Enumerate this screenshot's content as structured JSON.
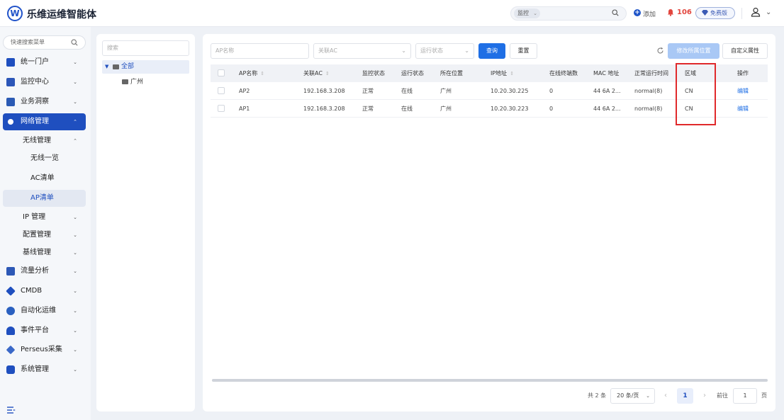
{
  "header": {
    "logo_letter": "W",
    "app_title": "乐维运维智能体",
    "search_scope": "监控",
    "add_label": "添加",
    "alert_count": "106",
    "edition_badge": "免费版"
  },
  "sidebar": {
    "search_placeholder": "快速搜索菜单",
    "items": [
      {
        "label": "统一门户"
      },
      {
        "label": "监控中心"
      },
      {
        "label": "业务洞察"
      },
      {
        "label": "网络管理"
      },
      {
        "label": "流量分析"
      },
      {
        "label": "CMDB"
      },
      {
        "label": "自动化运维"
      },
      {
        "label": "事件平台"
      },
      {
        "label": "Perseus采集"
      },
      {
        "label": "系统管理"
      }
    ],
    "sub_items": [
      {
        "label": "无线管理"
      },
      {
        "label": "IP 管理"
      },
      {
        "label": "配置管理"
      },
      {
        "label": "基线管理"
      }
    ],
    "leaf_items": [
      {
        "label": "无线一览"
      },
      {
        "label": "AC清单"
      },
      {
        "label": "AP清单"
      }
    ]
  },
  "tree": {
    "search_placeholder": "搜索",
    "root_label": "全部",
    "child_label": "广州"
  },
  "filters": {
    "ap_name_placeholder": "AP名称",
    "ac_placeholder": "关联AC",
    "status_placeholder": "运行状态",
    "query_label": "查询",
    "reset_label": "重置",
    "modify_location_label": "修改所属位置",
    "custom_attr_label": "自定义属性"
  },
  "table": {
    "columns": [
      "AP名称",
      "关联AC",
      "监控状态",
      "运行状态",
      "所在位置",
      "IP地址",
      "在线终端数",
      "MAC 地址",
      "正常运行时间",
      "区域",
      "操作"
    ],
    "rows": [
      [
        "AP2",
        "192.168.3.208",
        "正常",
        "在线",
        "广州",
        "10.20.30.225",
        "0",
        "44 6A 2...",
        "normal(8)",
        "CN",
        "编辑"
      ],
      [
        "AP1",
        "192.168.3.208",
        "正常",
        "在线",
        "广州",
        "10.20.30.223",
        "0",
        "44 6A 2...",
        "normal(8)",
        "CN",
        "编辑"
      ]
    ]
  },
  "pagination": {
    "total": "共 2 条",
    "page_size": "20 条/页",
    "current_page": "1",
    "goto_label": "前往",
    "goto_value": "1",
    "page_unit": "页"
  },
  "colors": {
    "primary": "#1f4fbf",
    "accent_button": "#1f6fe5",
    "alert": "#e2463e",
    "highlight": "#e0292b"
  }
}
